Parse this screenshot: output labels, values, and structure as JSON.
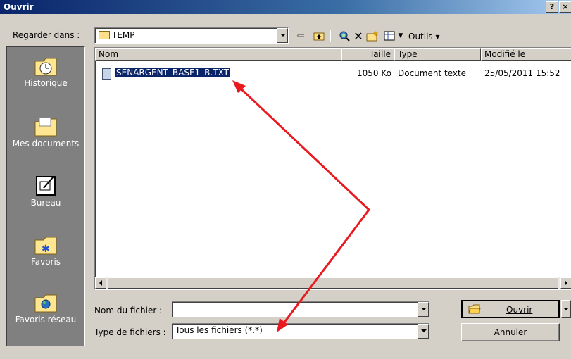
{
  "window": {
    "title": "Ouvrir",
    "help_btn": "?",
    "close_btn": "×"
  },
  "lookin": {
    "label": "Regarder dans :",
    "value": "TEMP"
  },
  "toolbar": {
    "tools_label": "Outils"
  },
  "places": [
    {
      "label": "Historique",
      "icon": "history-icon"
    },
    {
      "label": "Mes documents",
      "icon": "my-documents-icon"
    },
    {
      "label": "Bureau",
      "icon": "desktop-icon"
    },
    {
      "label": "Favoris",
      "icon": "favorites-icon"
    },
    {
      "label": "Favoris réseau",
      "icon": "network-favorites-icon"
    }
  ],
  "columns": {
    "name": "Nom",
    "size": "Taille",
    "type": "Type",
    "modified": "Modifié le"
  },
  "files": [
    {
      "name": "SENARGENT_BASE1_B.TXT",
      "size": "1050 Ko",
      "type": "Document texte",
      "modified": "25/05/2011 15:52",
      "selected": true
    }
  ],
  "filename": {
    "label": "Nom du fichier :",
    "value": ""
  },
  "filetype": {
    "label": "Type de fichiers :",
    "value": "Tous les fichiers (*.*)"
  },
  "buttons": {
    "open": "Ouvrir",
    "cancel": "Annuler"
  },
  "colors": {
    "annotation_arrow": "#e8191f",
    "selection": "#0a246a",
    "title_bar": "#0a246a"
  }
}
